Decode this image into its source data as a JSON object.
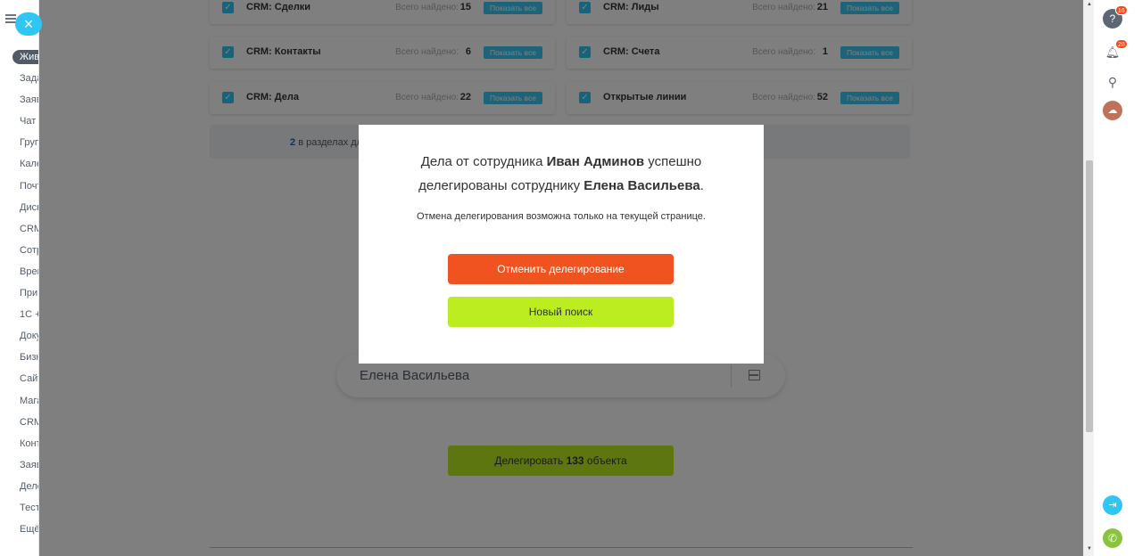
{
  "sidebar": {
    "items": [
      {
        "label": "Жив"
      },
      {
        "label": "Зада"
      },
      {
        "label": "Заяв"
      },
      {
        "label": "Чат"
      },
      {
        "label": "Груп"
      },
      {
        "label": "Кале"
      },
      {
        "label": "Почт"
      },
      {
        "label": "Диск"
      },
      {
        "label": "CRM"
      },
      {
        "label": "Сотр"
      },
      {
        "label": "Врем"
      },
      {
        "label": "При"
      },
      {
        "label": "1С +"
      },
      {
        "label": "Доку"
      },
      {
        "label": "Бизн"
      },
      {
        "label": "Сайт"
      },
      {
        "label": "Мага"
      },
      {
        "label": "CRM"
      },
      {
        "label": "Конт"
      },
      {
        "label": "Заяв"
      },
      {
        "label": "Деле"
      },
      {
        "label": "Тест"
      },
      {
        "label": "Ещё"
      }
    ]
  },
  "sections": [
    {
      "title": "CRM: Сделки",
      "found_label": "Всего найдено:",
      "count": "15",
      "show_label": "Показать все"
    },
    {
      "title": "CRM: Лиды",
      "found_label": "Всего найдено:",
      "count": "21",
      "show_label": "Показать все"
    },
    {
      "title": "CRM: Контакты",
      "found_label": "Всего найдено:",
      "count": "6",
      "show_label": "Показать все"
    },
    {
      "title": "CRM: Счета",
      "found_label": "Всего найдено:",
      "count": "1",
      "show_label": "Показать все"
    },
    {
      "title": "CRM: Дела",
      "found_label": "Всего найдено:",
      "count": "22",
      "show_label": "Показать все"
    },
    {
      "title": "Открытые линии",
      "found_label": "Всего найдено:",
      "count": "52",
      "show_label": "Показать все"
    }
  ],
  "hint": {
    "count": "2",
    "text": "в разделах дл"
  },
  "search": {
    "value": "Елена Васильева"
  },
  "delegate": {
    "prefix": "Делегировать ",
    "count": "133",
    "suffix": " объекта"
  },
  "modal": {
    "line1_a": "Дела от сотрудника ",
    "from_user": "Иван Админов",
    "line1_b": " успешно",
    "line2_a": "делегированы сотруднику ",
    "to_user": "Елена Васильева",
    "line2_b": ".",
    "note": "Отмена делегирования возможна только на текущей странице.",
    "cancel_label": "Отменить делегирование",
    "new_search_label": "Новый поиск"
  },
  "right_panel": {
    "help_badge": "16",
    "notify_badge": "28"
  },
  "colors": {
    "accent": "#2fc6f6",
    "cancel": "#f0531f",
    "green": "#bbed21"
  }
}
